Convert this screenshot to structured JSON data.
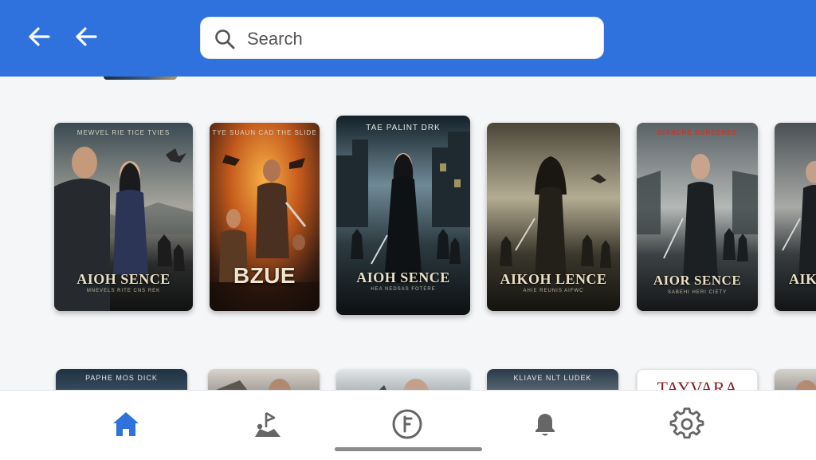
{
  "search": {
    "placeholder": "Search"
  },
  "colors": {
    "app_bar": "#2f72de",
    "active_nav": "#2f72de",
    "inactive_nav": "#666666"
  },
  "top_icons": [
    "back-arrow-icon",
    "back-arrow-icon"
  ],
  "posters": [
    {
      "top": "MEWVEL RIE TICE TVIES",
      "title": "AIOH SENCE",
      "subtitle": "MNEVELS RITE CNS REK"
    },
    {
      "top": "TYE SUAUN CAD THE SLIDE",
      "title": "BZUE",
      "subtitle": ""
    },
    {
      "top": "TAE PALINT DRK",
      "title": "AIOH SENCE",
      "subtitle": "HEA NEDSAS FOTERE"
    },
    {
      "top": "",
      "title": "AIKOH LENCE",
      "subtitle": "AHIE REUNIS AIFWC"
    },
    {
      "top": "DIANCHE DURCENES",
      "title": "AIOR SENCE",
      "subtitle": "SABEHI HERI CIETY"
    },
    {
      "top": "",
      "title": "AIK",
      "subtitle": ""
    }
  ],
  "second_row": [
    {
      "title": "PAPHE MOS DICK"
    },
    {
      "title": ""
    },
    {
      "title": ""
    },
    {
      "title": "KLIAVE NLT LUDEK"
    },
    {
      "title": "TAYVARA"
    },
    {
      "title": ""
    }
  ],
  "bottom_nav": [
    {
      "icon": "home-icon",
      "active": true
    },
    {
      "icon": "sports-icon",
      "active": false
    },
    {
      "icon": "circle-f-icon",
      "active": false
    },
    {
      "icon": "bell-icon",
      "active": false
    },
    {
      "icon": "gear-icon",
      "active": false
    }
  ]
}
